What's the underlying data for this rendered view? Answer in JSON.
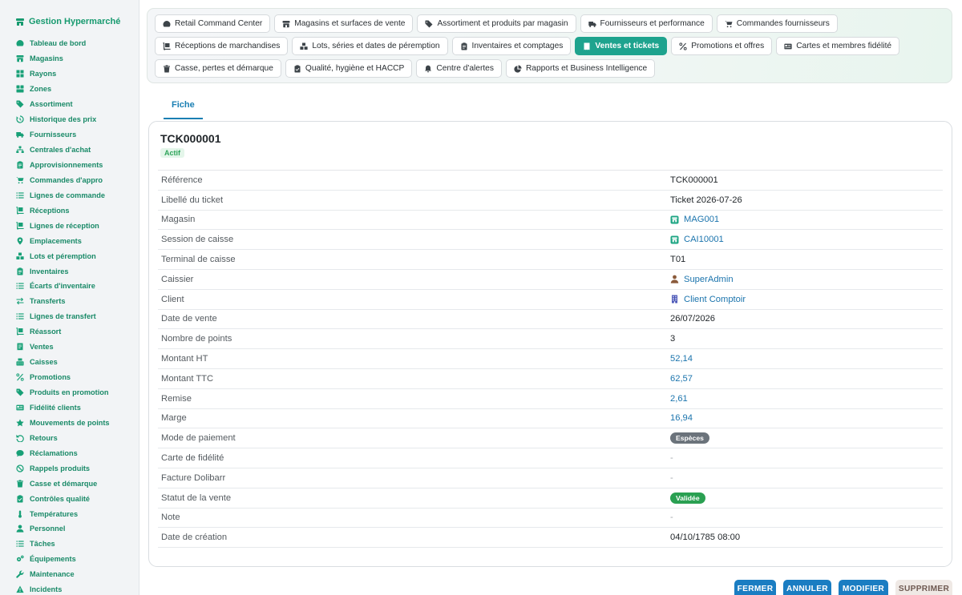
{
  "app": {
    "title": "Gestion Hypermarché",
    "brand_icon": "store-icon"
  },
  "sidebar": {
    "items": [
      {
        "label": "Tableau de bord",
        "icon": "dashboard-icon"
      },
      {
        "label": "Magasins",
        "icon": "store-icon"
      },
      {
        "label": "Rayons",
        "icon": "grid-icon"
      },
      {
        "label": "Zones",
        "icon": "layers-icon"
      },
      {
        "label": "Assortiment",
        "icon": "tags-icon"
      },
      {
        "label": "Historique des prix",
        "icon": "history-icon"
      },
      {
        "label": "Fournisseurs",
        "icon": "truck-icon"
      },
      {
        "label": "Centrales d'achat",
        "icon": "network-icon"
      },
      {
        "label": "Approvisionnements",
        "icon": "clipboard-icon"
      },
      {
        "label": "Commandes d'appro",
        "icon": "cart-icon"
      },
      {
        "label": "Lignes de commande",
        "icon": "list-icon"
      },
      {
        "label": "Réceptions",
        "icon": "dolly-icon"
      },
      {
        "label": "Lignes de réception",
        "icon": "dolly-icon"
      },
      {
        "label": "Emplacements",
        "icon": "pin-icon"
      },
      {
        "label": "Lots et péremption",
        "icon": "boxes-icon"
      },
      {
        "label": "Inventaires",
        "icon": "clipboard-icon"
      },
      {
        "label": "Écarts d'inventaire",
        "icon": "list-icon"
      },
      {
        "label": "Transferts",
        "icon": "exchange-icon"
      },
      {
        "label": "Lignes de transfert",
        "icon": "list-icon"
      },
      {
        "label": "Réassort",
        "icon": "dolly-icon"
      },
      {
        "label": "Ventes",
        "icon": "receipt-icon"
      },
      {
        "label": "Caisses",
        "icon": "register-icon"
      },
      {
        "label": "Promotions",
        "icon": "percent-icon"
      },
      {
        "label": "Produits en promotion",
        "icon": "tags-icon"
      },
      {
        "label": "Fidélité clients",
        "icon": "card-icon"
      },
      {
        "label": "Mouvements de points",
        "icon": "star-icon"
      },
      {
        "label": "Retours",
        "icon": "undo-icon"
      },
      {
        "label": "Réclamations",
        "icon": "comment-icon"
      },
      {
        "label": "Rappels produits",
        "icon": "ban-icon"
      },
      {
        "label": "Casse et démarque",
        "icon": "trash-icon"
      },
      {
        "label": "Contrôles qualité",
        "icon": "clipboard-check-icon"
      },
      {
        "label": "Températures",
        "icon": "thermometer-icon"
      },
      {
        "label": "Personnel",
        "icon": "user-icon"
      },
      {
        "label": "Tâches",
        "icon": "list-icon"
      },
      {
        "label": "Équipements",
        "icon": "cogs-icon"
      },
      {
        "label": "Maintenance",
        "icon": "wrench-icon"
      },
      {
        "label": "Incidents",
        "icon": "warning-icon"
      }
    ]
  },
  "topnav": {
    "rows": [
      [
        {
          "label": "Retail Command Center",
          "icon": "gauge-icon",
          "active": false
        },
        {
          "label": "Magasins et surfaces de vente",
          "icon": "store-icon",
          "active": false
        },
        {
          "label": "Assortiment et produits par magasin",
          "icon": "tags-icon",
          "active": false
        },
        {
          "label": "Fournisseurs et performance",
          "icon": "truck-icon",
          "active": false
        },
        {
          "label": "Commandes fournisseurs",
          "icon": "cart-icon",
          "active": false
        }
      ],
      [
        {
          "label": "Réceptions de marchandises",
          "icon": "dolly-icon",
          "active": false
        },
        {
          "label": "Lots, séries et dates de péremption",
          "icon": "boxes-icon",
          "active": false
        },
        {
          "label": "Inventaires et comptages",
          "icon": "clipboard-icon",
          "active": false
        },
        {
          "label": "Ventes et tickets",
          "icon": "receipt-icon",
          "active": true
        },
        {
          "label": "Promotions et offres",
          "icon": "percent-icon",
          "active": false
        },
        {
          "label": "Cartes et membres fidélité",
          "icon": "card-icon",
          "active": false
        }
      ],
      [
        {
          "label": "Casse, pertes et démarque",
          "icon": "trash-icon",
          "active": false
        },
        {
          "label": "Qualité, hygiène et HACCP",
          "icon": "clipboard-check-icon",
          "active": false
        },
        {
          "label": "Centre d'alertes",
          "icon": "bell-icon",
          "active": false
        },
        {
          "label": "Rapports et Business Intelligence",
          "icon": "chart-pie-icon",
          "active": false
        }
      ]
    ]
  },
  "tabs": [
    {
      "label": "Fiche",
      "active": true
    }
  ],
  "record": {
    "title": "TCK000001",
    "status": "Actif",
    "fields": [
      {
        "label": "Référence",
        "value": "TCK000001",
        "kind": "text"
      },
      {
        "label": "Libellé du ticket",
        "value": "Ticket 2026-07-26",
        "kind": "text"
      },
      {
        "label": "Magasin",
        "value": "MAG001",
        "kind": "link",
        "icon": "store-badge-icon"
      },
      {
        "label": "Session de caisse",
        "value": "CAI10001",
        "kind": "link",
        "icon": "store-badge-icon"
      },
      {
        "label": "Terminal de caisse",
        "value": "T01",
        "kind": "text"
      },
      {
        "label": "Caissier",
        "value": "SuperAdmin",
        "kind": "link",
        "icon": "user-icon"
      },
      {
        "label": "Client",
        "value": "Client Comptoir",
        "kind": "link",
        "icon": "building-icon"
      },
      {
        "label": "Date de vente",
        "value": "26/07/2026",
        "kind": "text"
      },
      {
        "label": "Nombre de points",
        "value": "3",
        "kind": "text"
      },
      {
        "label": "Montant HT",
        "value": "52,14",
        "kind": "num"
      },
      {
        "label": "Montant TTC",
        "value": "62,57",
        "kind": "num"
      },
      {
        "label": "Remise",
        "value": "2,61",
        "kind": "num"
      },
      {
        "label": "Marge",
        "value": "16,94",
        "kind": "num"
      },
      {
        "label": "Mode de paiement",
        "value": "Espèces",
        "kind": "pill-grey"
      },
      {
        "label": "Carte de fidélité",
        "value": "-",
        "kind": "dash"
      },
      {
        "label": "Facture Dolibarr",
        "value": "-",
        "kind": "dash"
      },
      {
        "label": "Statut de la vente",
        "value": "Validée",
        "kind": "pill-green"
      },
      {
        "label": "Note",
        "value": "-",
        "kind": "dash"
      },
      {
        "label": "Date de création",
        "value": "04/10/1785 08:00",
        "kind": "text"
      }
    ]
  },
  "actions": {
    "close": "FERMER",
    "cancel": "ANNULER",
    "edit": "MODIFIER",
    "delete": "SUPPRIMER"
  },
  "colors": {
    "brand": "#179a6f",
    "active_tab": "#1ea38e",
    "link": "#1b74ad",
    "action_blue": "#1a7dc2"
  }
}
